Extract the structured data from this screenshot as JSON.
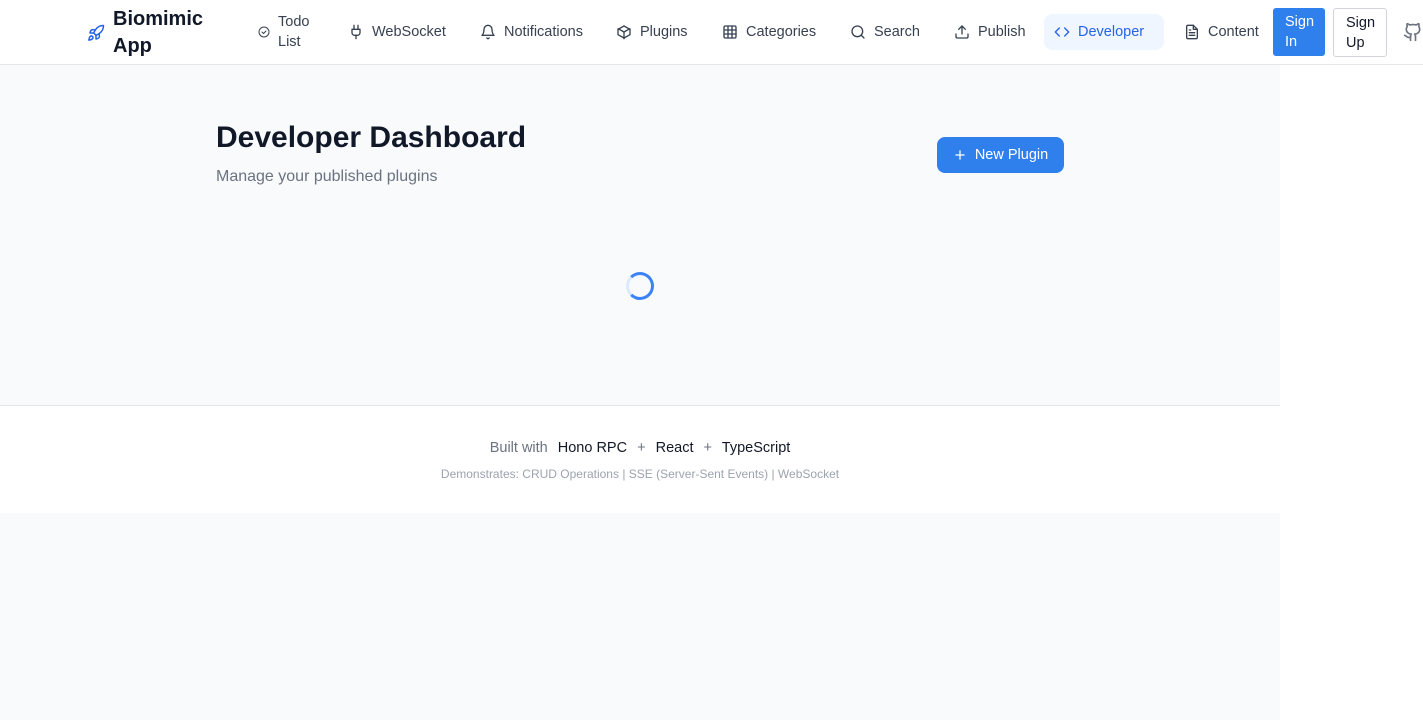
{
  "app": {
    "name": "Biomimic App",
    "brand_icon": "rocket-icon",
    "accent": "#2f80ed"
  },
  "nav": {
    "todo": "Todo List",
    "websocket": "WebSocket",
    "notifications": "Notifications",
    "plugins": "Plugins",
    "categories": "Categories",
    "search": "Search",
    "publish": "Publish",
    "developer": "Developer",
    "content": "Content",
    "active": "Developer"
  },
  "auth": {
    "sign_in": "Sign In",
    "sign_up": "Sign Up",
    "github_icon": "github-icon"
  },
  "page": {
    "title": "Developer Dashboard",
    "subtitle": "Manage your published plugins",
    "new_plugin": "New Plugin",
    "loading_icon": "spinner-icon"
  },
  "footer": {
    "built_with": "Built with",
    "tech": [
      "Hono RPC",
      "React",
      "TypeScript"
    ],
    "plus": "+",
    "demonstrates": "Demonstrates: CRUD Operations | SSE (Server-Sent Events) | WebSocket"
  }
}
